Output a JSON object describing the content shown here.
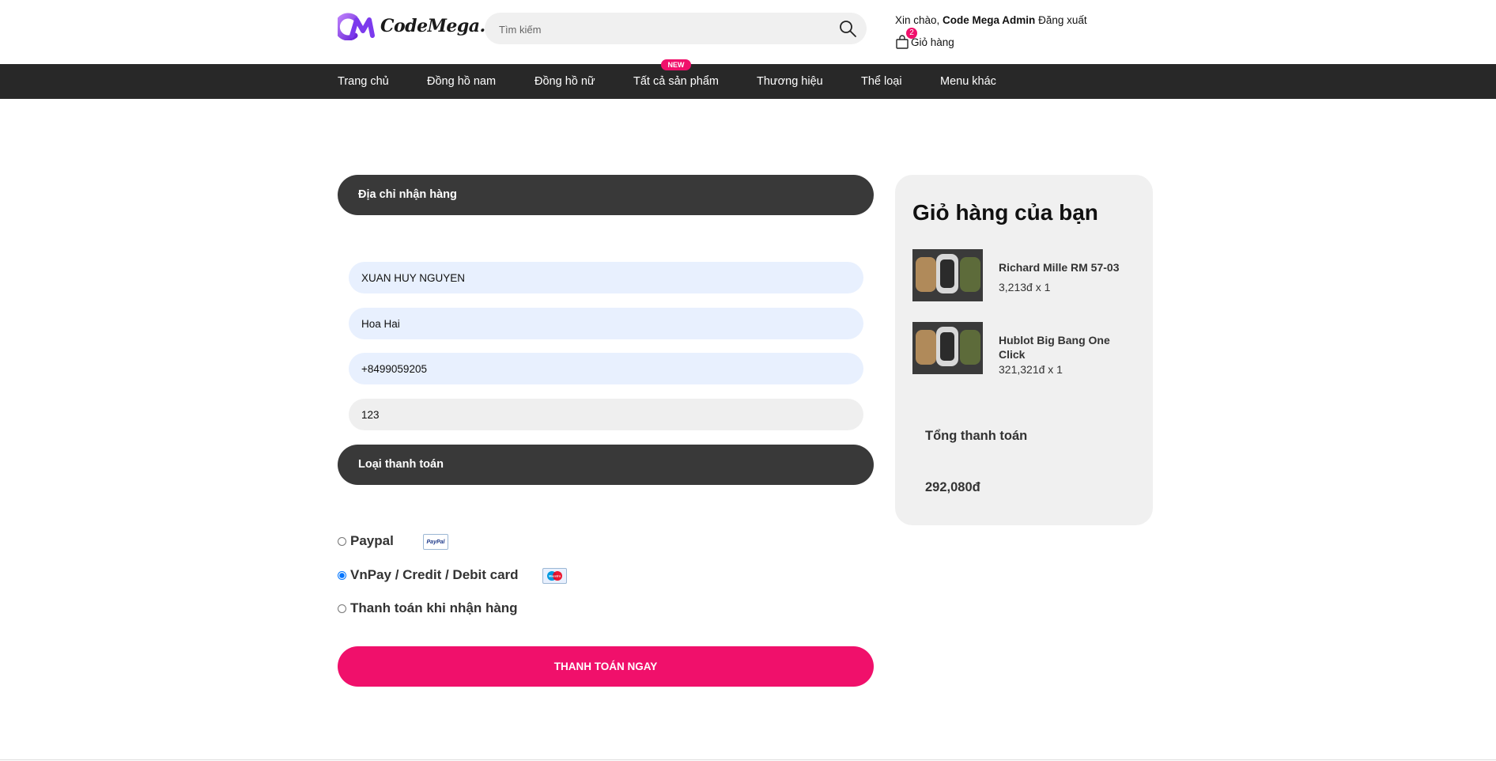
{
  "header": {
    "logo_text": "CodeMega.",
    "search_placeholder": "Tìm kiếm",
    "greeting_prefix": "Xin chào, ",
    "user_name": "Code Mega Admin",
    "logout_label": "Đăng xuất",
    "cart_count": "2",
    "cart_label": "Giỏ hàng"
  },
  "nav": {
    "items": [
      "Trang chủ",
      "Đồng hồ nam",
      "Đồng hồ nữ",
      "Tất cả sản phẩm",
      "Thương hiệu",
      "Thể loại",
      "Menu khác"
    ],
    "new_badge": "NEW"
  },
  "shipping": {
    "title": "Địa chỉ nhận hàng",
    "fields": [
      "XUAN HUY NGUYEN",
      "Hoa Hai",
      "+8499059205",
      "123"
    ]
  },
  "payment": {
    "title": "Loại thanh toán",
    "options": [
      {
        "label": "Paypal",
        "selected": false,
        "logo": "PayPal"
      },
      {
        "label": "VnPay / Credit / Debit card",
        "selected": true,
        "logo": "Maestro"
      },
      {
        "label": "Thanh toán khi nhận hàng",
        "selected": false
      }
    ],
    "submit_label": "THANH TOÁN NGAY"
  },
  "cart": {
    "title": "Giỏ hàng của bạn",
    "items": [
      {
        "name": "Richard Mille RM 57-03",
        "price": "3,213đ x 1"
      },
      {
        "name": "Hublot Big Bang One Click",
        "price": "321,321đ x 1"
      }
    ],
    "total_label": "Tổng thanh toán",
    "total_value": "292,080đ"
  },
  "colors": {
    "accent": "#f0106b",
    "nav_bg": "#282828",
    "section_bg": "#393939"
  }
}
